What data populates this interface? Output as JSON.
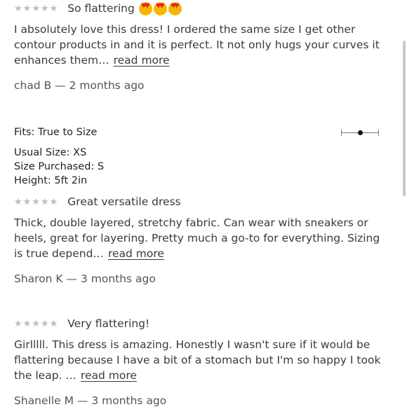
{
  "reviews": [
    {
      "stars": "★★★★★",
      "title": "So flattering",
      "body": "I absolutely love this dress! I ordered the same size I get other contour products in and it is perfect. It not only hugs your curves it enhances them…",
      "read_more": "read more",
      "author_date": "chad B — 2 months ago"
    },
    {
      "stars": "★★★★★",
      "title": "Great versatile dress",
      "body": "Thick, double layered, stretchy fabric. Can wear with sneakers or heels, great for layering. Pretty much a go-to for everything. Sizing is true depend…",
      "read_more": "read more",
      "author_date": "Sharon K — 3 months ago"
    },
    {
      "stars": "★★★★★",
      "title": "Very flattering!",
      "body": "Girlllll. This dress is amazing. Honestly I wasn't sure if it would be flattering because I have a bit of a stomach but I'm so happy I took the leap. …",
      "read_more": "read more",
      "author_date": "Shanelle M — 3 months ago"
    }
  ],
  "review1_emoji": [
    "heart-eyes-emoji",
    "heart-eyes-emoji",
    "heart-eyes-emoji"
  ],
  "fit": {
    "label": "Fits: True to Size",
    "slider_position_fraction": 0.5
  },
  "sizes": {
    "usual": "Usual Size:  XS",
    "purchased": "Size Purchased:  S",
    "height": "Height:  5ft 2in"
  },
  "colors": {
    "text": "#3a3a3a",
    "stars": "#bcbcbc",
    "emoji_face": "#f7b500",
    "emoji_heart": "#e0222a"
  }
}
